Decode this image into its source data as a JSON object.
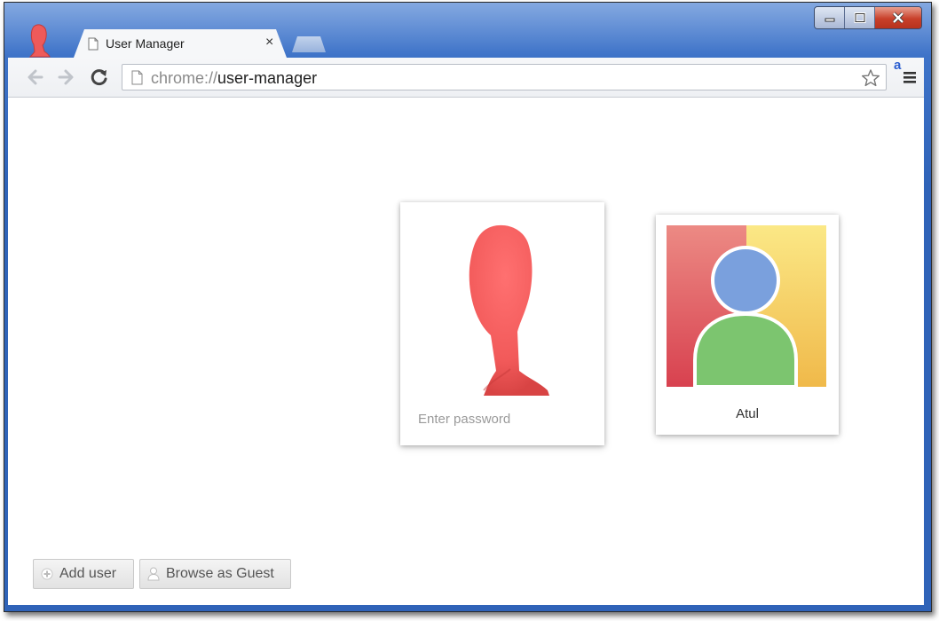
{
  "window": {
    "controls": [
      "minimize",
      "restore",
      "close"
    ]
  },
  "tab": {
    "title": "User Manager",
    "close_label": "×",
    "favicon": "page-icon"
  },
  "toolbar": {
    "back_icon": "back-arrow-icon",
    "forward_icon": "forward-arrow-icon",
    "reload_icon": "reload-icon",
    "url_scheme": "chrome://",
    "url_path": "user-manager",
    "star_icon": "star-icon",
    "extension_label": "a",
    "menu_icon": "hamburger-menu-icon"
  },
  "profiles": [
    {
      "avatar": "red-head-avatar",
      "password_placeholder": "Enter password"
    },
    {
      "avatar": "generic-user-avatar",
      "name": "Atul",
      "colors": [
        "#e0525e",
        "#fbd85a",
        "#7aa0dd",
        "#7cc56f"
      ]
    }
  ],
  "actions": {
    "add_user": "Add user",
    "browse_guest": "Browse as Guest"
  }
}
